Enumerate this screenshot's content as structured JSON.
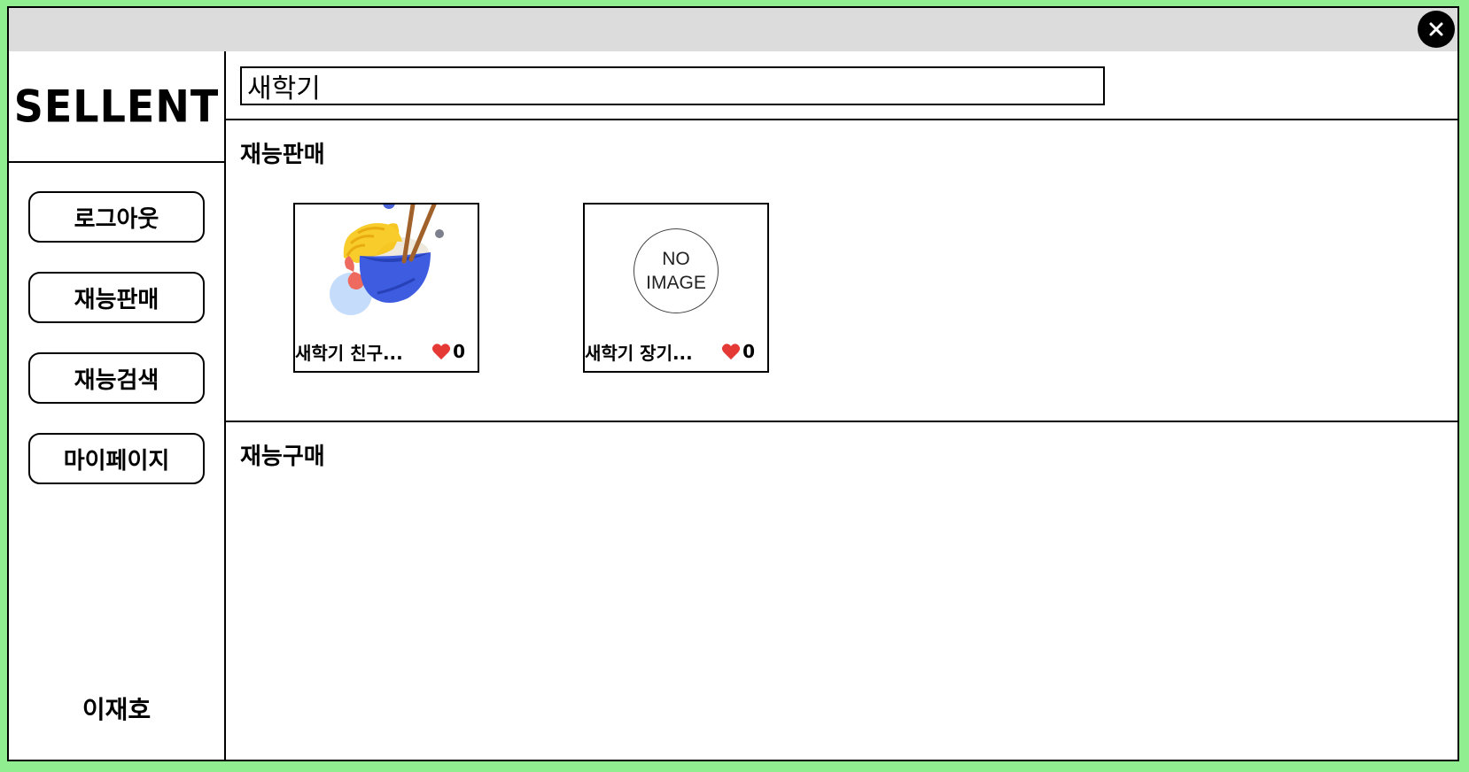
{
  "window": {
    "close_label": "X"
  },
  "sidebar": {
    "logo": "SELLENT",
    "items": [
      {
        "label": "로그아웃"
      },
      {
        "label": "재능판매"
      },
      {
        "label": "재능검색"
      },
      {
        "label": "마이페이지"
      }
    ],
    "username": "이재호"
  },
  "search": {
    "value": "새학기"
  },
  "sections": {
    "sell": {
      "title": "재능판매",
      "cards": [
        {
          "title": "새학기 친구...",
          "likes": "0",
          "image": "food-bowl-illustration"
        },
        {
          "title": "새학기 장기...",
          "likes": "0",
          "image": "no-image-placeholder",
          "placeholder_text": "NO IMAGE"
        }
      ]
    },
    "buy": {
      "title": "재능구매"
    }
  },
  "colors": {
    "background": "#90ee90",
    "titlebar": "#dcdcdc",
    "heart": "#e53935",
    "bowl": "#3d5ce0",
    "shrimp": "#f6c623"
  }
}
